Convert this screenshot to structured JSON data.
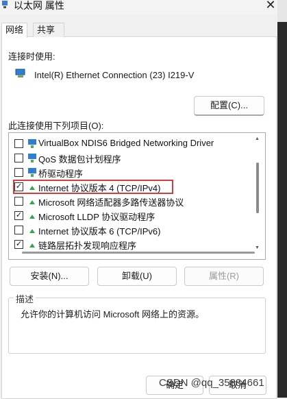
{
  "window": {
    "title": "以太网 属性",
    "close_glyph": "✕"
  },
  "tabs": [
    {
      "label": "网络"
    },
    {
      "label": "共享"
    }
  ],
  "connect_using": {
    "label": "连接时使用:",
    "adapter_name": "Intel(R) Ethernet Connection (23) I219-V",
    "configure_button": "配置(C)..."
  },
  "items_section": {
    "label": "此连接使用下列项目(O):",
    "items": [
      {
        "label": "VirtualBox NDIS6 Bridged Networking Driver",
        "checked": false,
        "icon": "network-client-icon"
      },
      {
        "label": "QoS 数据包计划程序",
        "checked": false,
        "icon": "network-client-icon"
      },
      {
        "label": "桥驱动程序",
        "checked": false,
        "icon": "network-client-icon"
      },
      {
        "label": "Internet 协议版本 4 (TCP/IPv4)",
        "checked": true,
        "icon": "protocol-icon"
      },
      {
        "label": "Microsoft 网络适配器多路传送器协议",
        "checked": false,
        "icon": "protocol-icon"
      },
      {
        "label": "Microsoft LLDP 协议驱动程序",
        "checked": true,
        "icon": "protocol-icon"
      },
      {
        "label": "Internet 协议版本 6 (TCP/IPv6)",
        "checked": false,
        "icon": "protocol-icon"
      },
      {
        "label": "链路层拓扑发现响应程序",
        "checked": true,
        "icon": "protocol-icon"
      }
    ]
  },
  "buttons": {
    "install": "安装(N)...",
    "uninstall": "卸载(U)",
    "properties": "属性(R)"
  },
  "description": {
    "title": "描述",
    "text": "允许你的计算机访问 Microsoft 网络上的资源。"
  },
  "footer": {
    "ok": "确定",
    "cancel": "取消",
    "watermark": "CSDN @qq_35884661"
  },
  "colors": {
    "highlight_border": "#d83b3b",
    "protocol_icon": "#2fa84f"
  }
}
